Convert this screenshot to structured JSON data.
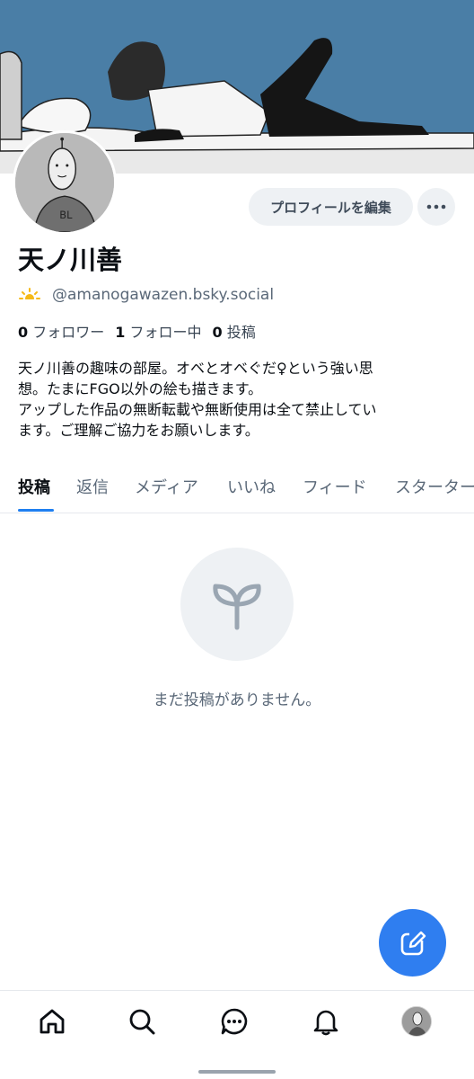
{
  "profile": {
    "edit_label": "プロフィールを編集",
    "display_name": "天ノ川善",
    "handle_emoji": "🌤",
    "handle": "@amanogawazen.bsky.social"
  },
  "stats": {
    "followers_count": "0",
    "followers_label": "フォロワー",
    "following_count": "1",
    "following_label": "フォロー中",
    "posts_count": "0",
    "posts_label": "投稿"
  },
  "bio": {
    "lines": [
      "天ノ川善の趣味の部屋。オベとオベぐだ♀という強い思",
      "想。たまにFGO以外の絵も描きます。",
      "アップした作品の無断転載や無断使用は全て禁止してい",
      "ます。ご理解ご協力をお願いします。"
    ]
  },
  "tabs": [
    "投稿",
    "返信",
    "メディア",
    "いいね",
    "フィード",
    "スターター"
  ],
  "empty_state": {
    "icon": "sprout-icon",
    "text": "まだ投稿がありません。"
  },
  "fab": {
    "icon": "compose-icon"
  },
  "bottom_nav": {
    "items": [
      "home-icon",
      "search-icon",
      "chat-icon",
      "bell-icon",
      "profile-avatar"
    ]
  },
  "colors": {
    "accent": "#1f7ff0",
    "fab": "#2f7ef0",
    "banner_sky": "#4a7ea6",
    "muted_text": "#5a6878",
    "pill_bg": "#eef1f4"
  }
}
